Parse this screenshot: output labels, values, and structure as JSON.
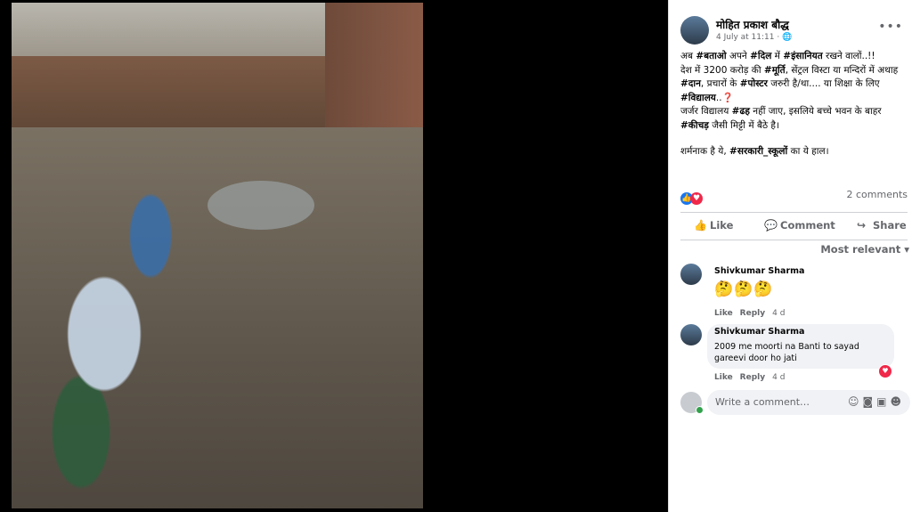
{
  "post": {
    "author": "मोहित प्रकाश बौद्ध",
    "date": "4 July at 11:11",
    "sep": "·",
    "privacy_icon": "globe-icon",
    "more_icon": "ellipsis-icon",
    "lines": [
      {
        "parts": [
          "अब ",
          "#बताओ",
          " अपने ",
          "#दिल",
          " में ",
          "#इंसानियत",
          " रखने वालों..!!"
        ]
      },
      {
        "parts": [
          "देश में 3200 करोड़ की ",
          "#मूर्ति",
          ", सेंट्रल विस्टा या मन्दिरों में अथाह ",
          "#दान",
          ", प्रचारों के ",
          "#पोस्टर",
          " जरुरी है/था.... या शिक्षा के लिए ",
          "#विद्यालय",
          "..❓"
        ]
      },
      {
        "parts": [
          "जर्जर विद्यालय ",
          "#ढह",
          " नहीं जाए, इसलिये बच्चे भवन के बाहर ",
          "#कीचड़",
          " जैसी मिट्टी में बैठे है।"
        ]
      },
      {
        "parts": [
          "शर्मनाक है ये, ",
          "#सरकारी_स्कूलों",
          " का ये हाल।"
        ]
      }
    ],
    "comment_count": "2 comments"
  },
  "actions": {
    "like": "Like",
    "comment": "Comment",
    "share": "Share"
  },
  "sort": "Most relevant",
  "comments": [
    {
      "author": "Shivkumar Sharma",
      "text": "🤔🤔🤔",
      "like": "Like",
      "reply": "Reply",
      "time": "4 d"
    },
    {
      "author": "Shivkumar Sharma",
      "text": "2009 me moorti na Banti to sayad gareevi door ho jati",
      "like": "Like",
      "reply": "Reply",
      "time": "4 d"
    }
  ],
  "write": {
    "placeholder": "Write a comment…"
  },
  "colors": {
    "accent": "#1877f2",
    "heart": "#f02849"
  }
}
